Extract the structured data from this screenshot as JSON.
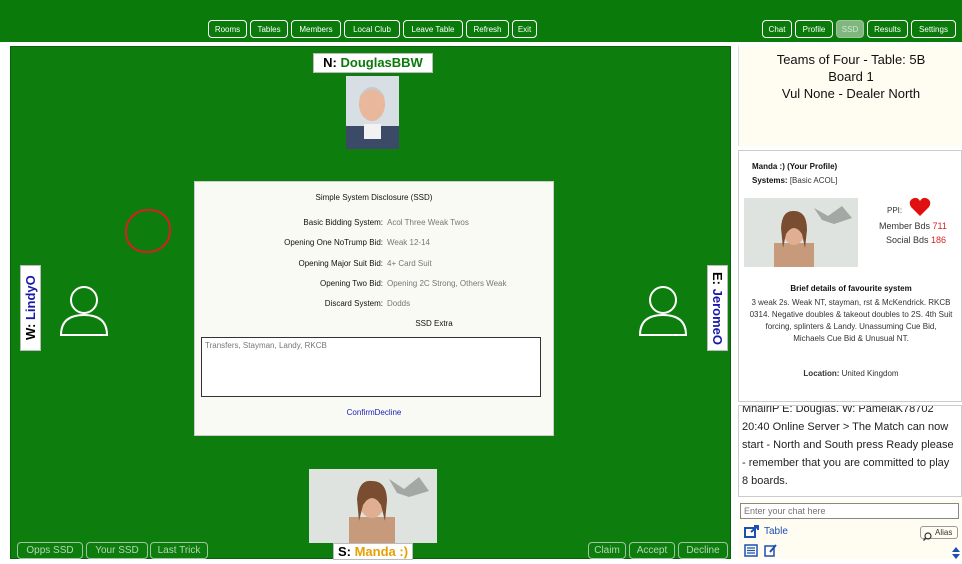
{
  "nav": {
    "left_buttons": [
      "Rooms",
      "Tables",
      "Members",
      "Local Club",
      "Leave Table",
      "Refresh",
      "Exit"
    ],
    "right_buttons": [
      "Chat",
      "Profile",
      "SSD",
      "Results",
      "Settings"
    ],
    "disabled": "SSD"
  },
  "seats": {
    "north": {
      "prefix": "N: ",
      "name": "DouglasBBW"
    },
    "west": {
      "prefix": "W: ",
      "name": "LindyO"
    },
    "east": {
      "prefix": "E: ",
      "name": "JeromeO"
    },
    "south": {
      "prefix": "S: ",
      "name": "Manda :)"
    }
  },
  "ssd": {
    "title": "Simple System Disclosure (SSD)",
    "rows": [
      {
        "k": "Basic Bidding System:",
        "v": "Acol Three Weak Twos"
      },
      {
        "k": "Opening One NoTrump Bid:",
        "v": "Weak 12-14"
      },
      {
        "k": "Opening Major Suit Bid:",
        "v": "4+ Card Suit"
      },
      {
        "k": "Opening Two Bid:",
        "v": "Opening 2C Strong, Others Weak"
      },
      {
        "k": "Discard System:",
        "v": "Dodds"
      }
    ],
    "extra_label": "SSD Extra",
    "extra_text": "Transfers, Stayman, Landy, RKCB",
    "confirm": "Confirm",
    "decline": "Decline"
  },
  "bottom_left": [
    "Opps SSD",
    "Your SSD",
    "Last Trick"
  ],
  "bottom_right": [
    "Claim",
    "Accept",
    "Decline"
  ],
  "info": {
    "line1": "Teams of Four - Table: 5B",
    "line2": "Board 1",
    "line3": "Vul None - Dealer North"
  },
  "profile": {
    "heading": "Manda :) (Your Profile)",
    "systems_label": "Systems:",
    "systems_value": "[Basic ACOL]",
    "ppi_label": "PPI:",
    "member_bds_label": "Member Bds",
    "member_bds_value": "711",
    "social_bds_label": "Social Bds",
    "social_bds_value": "186",
    "fav_title": "Brief details of favourite system",
    "fav_text": "3 weak 2s. Weak NT, stayman, rst & McKendrick. RKCB 0314. Negative doubles & takeout doubles to 2S. 4th Suit forcing, splinters & Landy. Unassuming Cue Bid, Michaels Cue Bid & Unusual NT.",
    "location_label": "Location:",
    "location_value": "United Kingdom"
  },
  "chat": {
    "text": "MhairiP E: Douglas. W: PamelaK78702 20:40 Online Server > The Match can now start - North and South press Ready please - remember that you are committed to play 8 boards."
  },
  "chat_input": {
    "placeholder": "Enter your chat here",
    "target": "Table",
    "alias": "Alias"
  },
  "colors": {
    "table_green": "#0d7d0d",
    "heart": "#e01010",
    "red_value": "#e02020"
  }
}
